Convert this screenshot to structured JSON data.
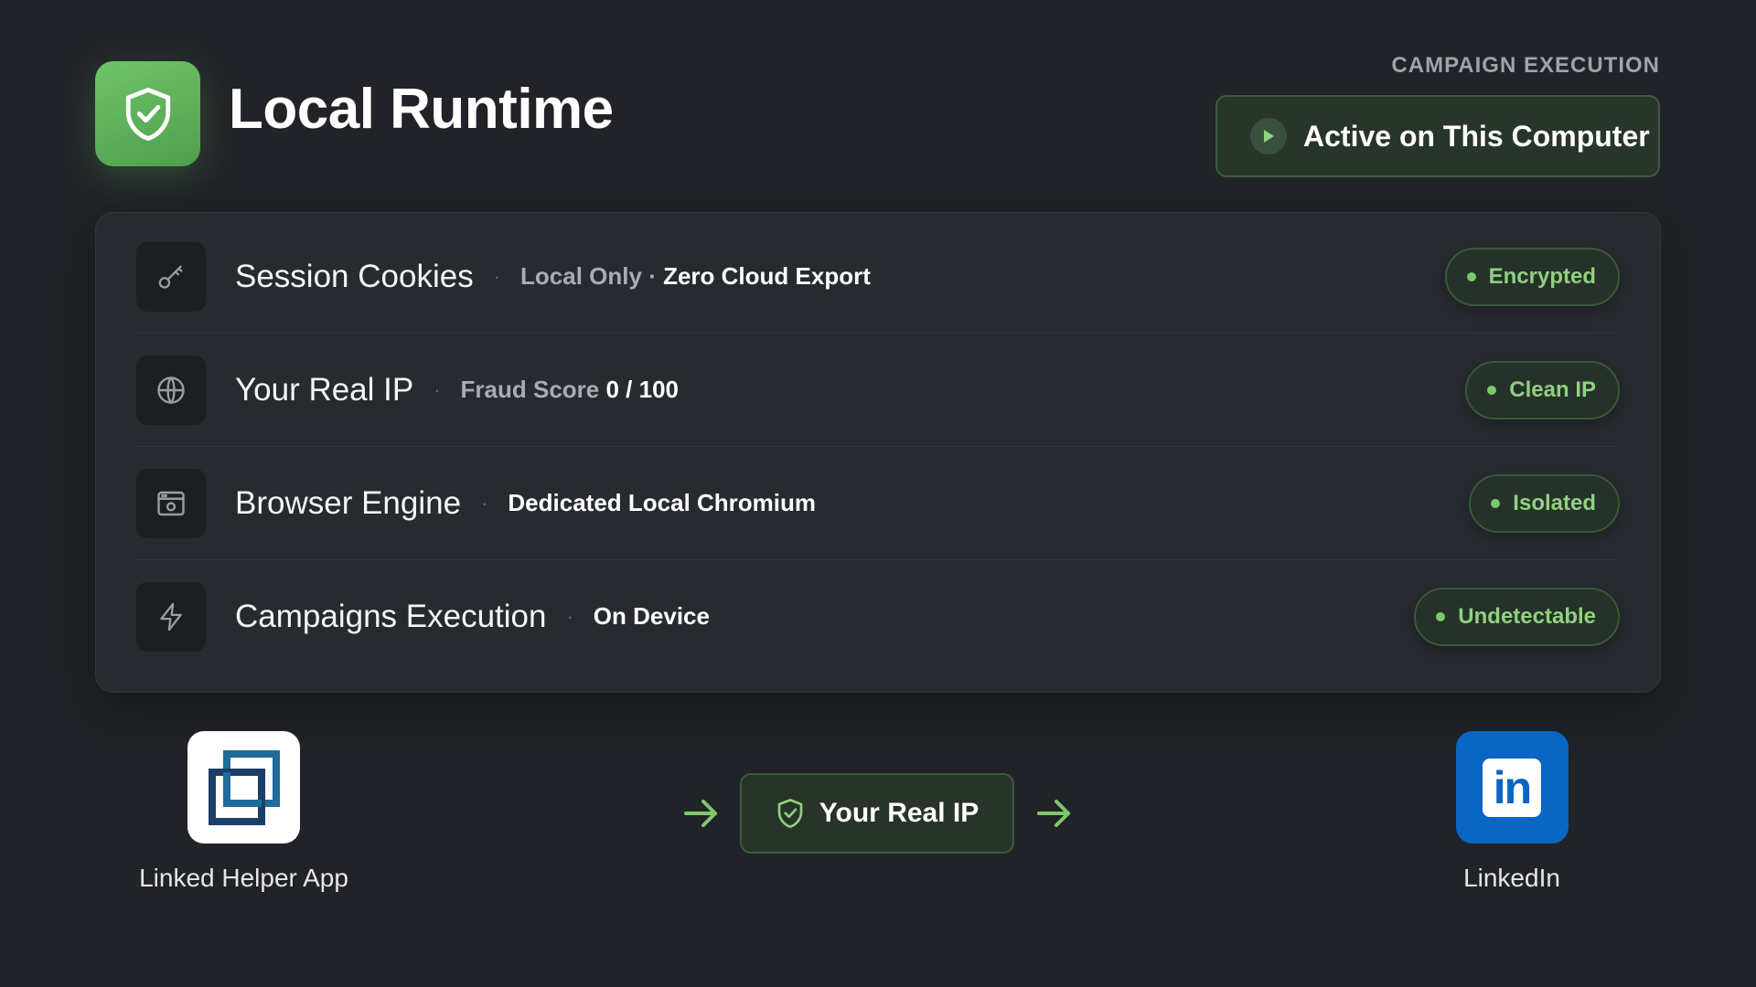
{
  "header": {
    "title": "Local Runtime",
    "logo_icon": "shield-check-icon",
    "section_label": "CAMPAIGN EXECUTION",
    "status_button": {
      "label": "Active on This Computer",
      "icon": "play-icon"
    }
  },
  "status_rows": [
    {
      "icon": "key-icon",
      "title": "Session Cookies",
      "detail_muted": "Local Only",
      "detail_joiner": "·",
      "detail_strong": "Zero Cloud Export",
      "badge": "Encrypted"
    },
    {
      "icon": "globe-icon",
      "title": "Your Real IP",
      "detail_muted": "Fraud Score",
      "detail_strong": "0 / 100",
      "badge": "Clean IP"
    },
    {
      "icon": "browser-window-icon",
      "title": "Browser Engine",
      "detail_strong": "Dedicated Local Chromium",
      "badge": "Isolated"
    },
    {
      "icon": "lightning-icon",
      "title": "Campaigns Execution",
      "detail_strong": "On Device",
      "badge": "Undetectable"
    }
  ],
  "separator": "·",
  "flow": {
    "source": {
      "label": "Linked Helper App",
      "icon": "linked-helper-logo-icon"
    },
    "middle": {
      "label": "Your Real IP",
      "icon": "shield-check-icon"
    },
    "target": {
      "label": "LinkedIn",
      "icon": "linkedin-logo-icon",
      "logo_text": "in"
    }
  },
  "colors": {
    "background": "#212328",
    "accent_green": "#8fd17f",
    "logo_green": "#5fb35a",
    "linkedin_blue": "#0a66c2"
  }
}
